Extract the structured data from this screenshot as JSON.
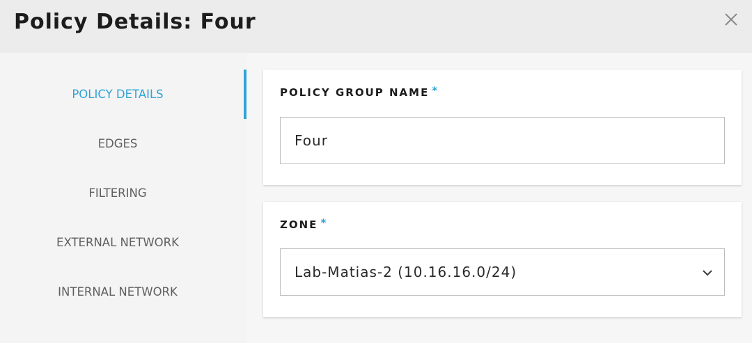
{
  "dialog": {
    "title": "Policy Details: Four",
    "close_icon": "close-icon"
  },
  "nav": {
    "items": [
      {
        "label": "POLICY DETAILS",
        "active": true
      },
      {
        "label": "EDGES",
        "active": false
      },
      {
        "label": "FILTERING",
        "active": false
      },
      {
        "label": "EXTERNAL NETWORK",
        "active": false
      },
      {
        "label": "INTERNAL NETWORK",
        "active": false
      }
    ]
  },
  "form": {
    "policy_group_name": {
      "label": "POLICY GROUP NAME",
      "required_marker": "*",
      "value": "Four"
    },
    "zone": {
      "label": "ZONE",
      "required_marker": "*",
      "selected": "Lab-Matias-2 (10.16.16.0/24)",
      "icon": "chevron-down-icon"
    }
  },
  "colors": {
    "accent": "#2fa3d6",
    "header_bg": "#ececec",
    "text": "#1c1c1c",
    "nav_text": "#5f5f5f"
  }
}
